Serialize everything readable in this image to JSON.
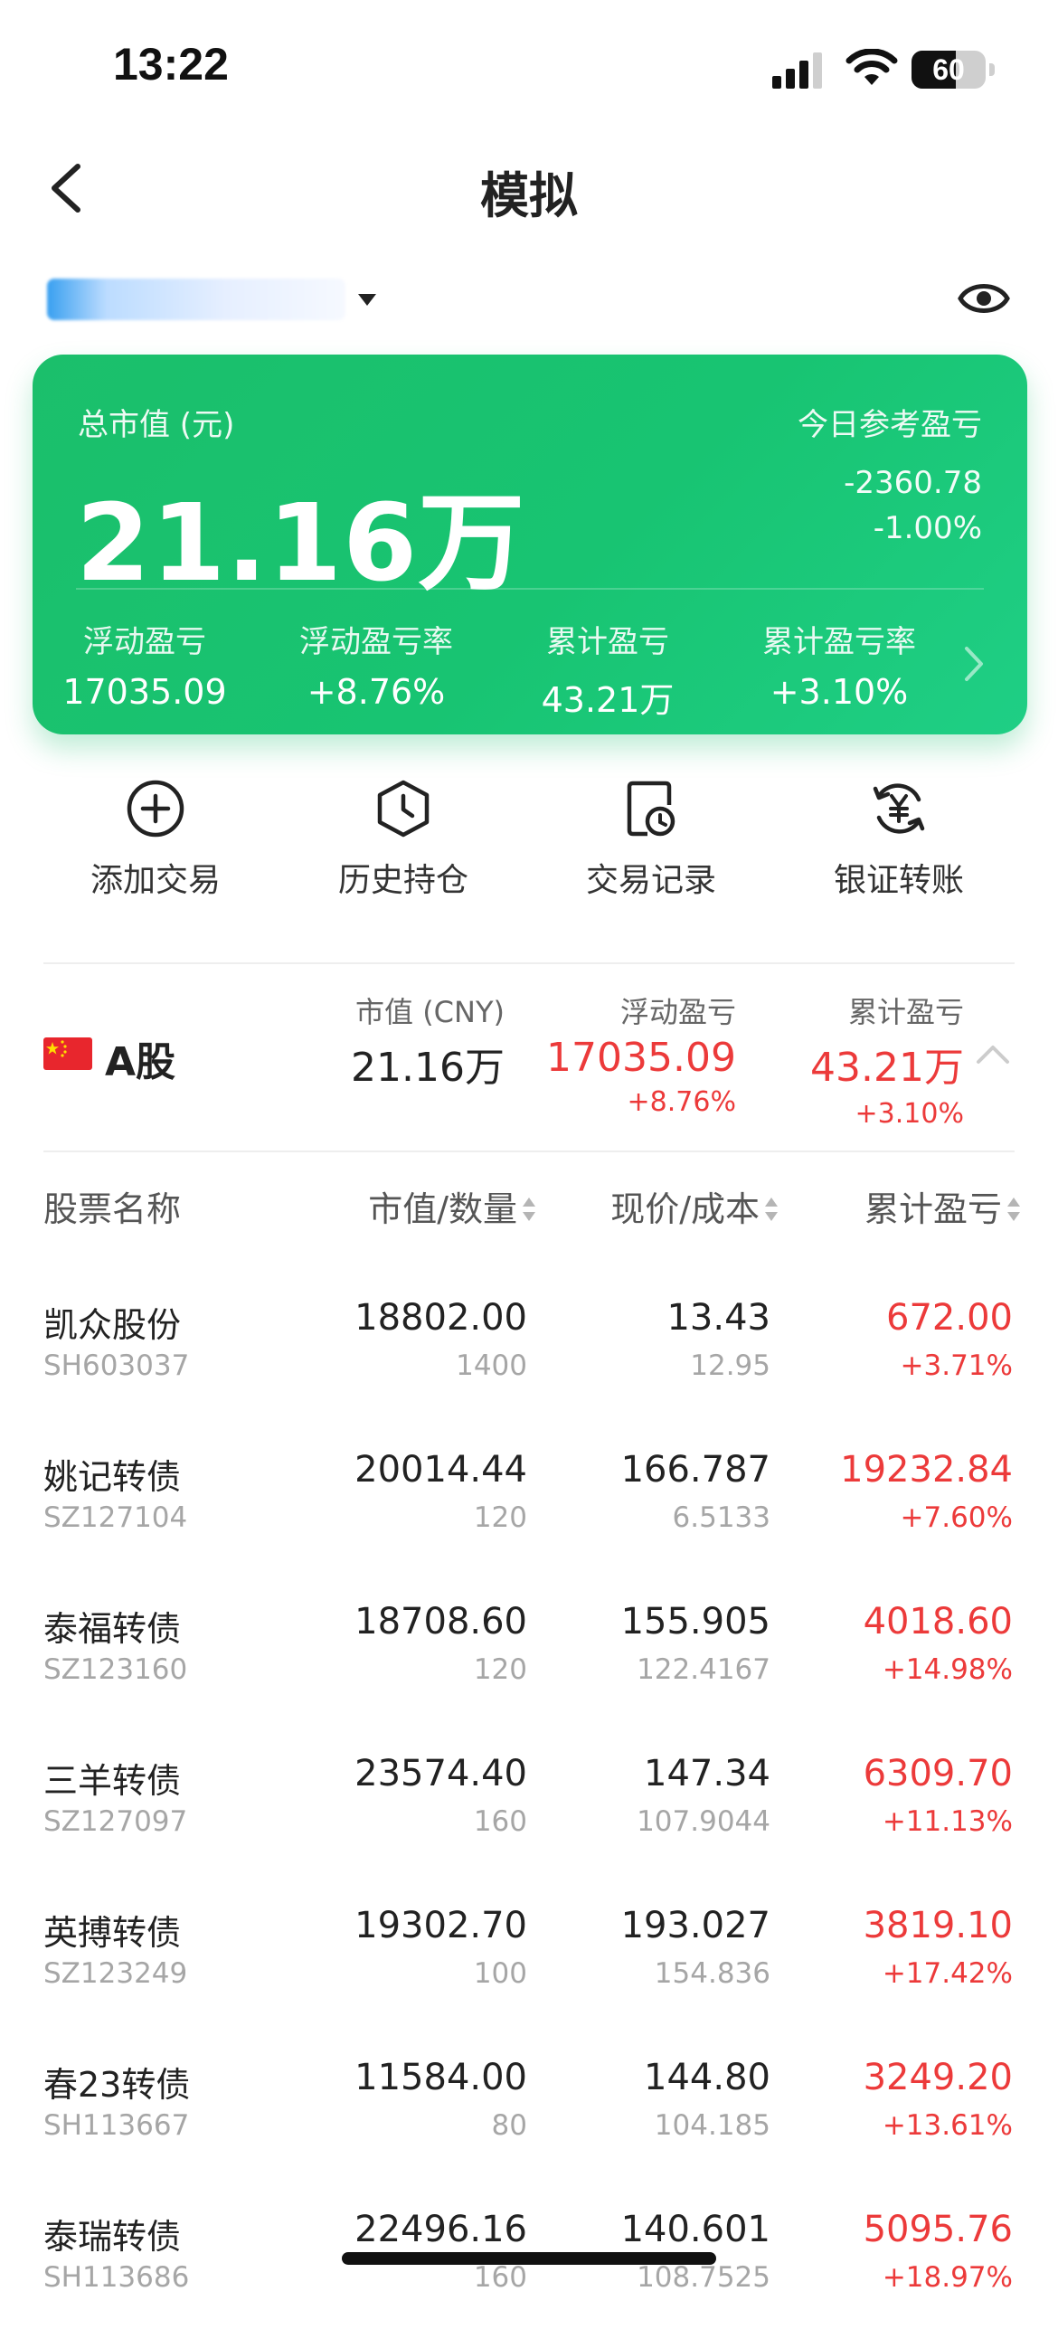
{
  "status_bar": {
    "time": "13:22",
    "battery_level": "60"
  },
  "nav": {
    "title": "模拟"
  },
  "card": {
    "total_label": "总市值 (元)",
    "total_value": "21.16万",
    "today_label": "今日参考盈亏",
    "today_value": "-2360.78",
    "today_pct": "-1.00%",
    "metrics": [
      {
        "label": "浮动盈亏",
        "value": "17035.09"
      },
      {
        "label": "浮动盈亏率",
        "value": "+8.76%"
      },
      {
        "label": "累计盈亏",
        "value": "43.21万"
      },
      {
        "label": "累计盈亏率",
        "value": "+3.10%"
      }
    ],
    "colors": {
      "start": "#1bbf6b",
      "end": "#1fcf85"
    }
  },
  "actions": [
    {
      "label": "添加交易",
      "icon": "plus-circle-icon"
    },
    {
      "label": "历史持仓",
      "icon": "clock-hexagon-icon"
    },
    {
      "label": "交易记录",
      "icon": "document-clock-icon"
    },
    {
      "label": "银证转账",
      "icon": "yuan-transfer-icon"
    }
  ],
  "summary": {
    "market": "A股",
    "market_value_label": "市值 (CNY)",
    "market_value": "21.16万",
    "float_label": "浮动盈亏",
    "float_value": "17035.09",
    "float_pct": "+8.76%",
    "cum_label": "累计盈亏",
    "cum_value": "43.21万",
    "cum_pct": "+3.10%"
  },
  "table": {
    "headers": {
      "name": "股票名称",
      "value_qty": "市值/数量",
      "price_cost": "现价/成本",
      "cum_pnl": "累计盈亏"
    },
    "rows": [
      {
        "name": "凯众股份",
        "code": "SH603037",
        "market_value": "18802.00",
        "quantity": "1400",
        "price": "13.43",
        "cost": "12.95",
        "pnl": "672.00",
        "pnl_pct": "+3.71%"
      },
      {
        "name": "姚记转债",
        "code": "SZ127104",
        "market_value": "20014.44",
        "quantity": "120",
        "price": "166.787",
        "cost": "6.5133",
        "pnl": "19232.84",
        "pnl_pct": "+7.60%"
      },
      {
        "name": "泰福转债",
        "code": "SZ123160",
        "market_value": "18708.60",
        "quantity": "120",
        "price": "155.905",
        "cost": "122.4167",
        "pnl": "4018.60",
        "pnl_pct": "+14.98%"
      },
      {
        "name": "三羊转债",
        "code": "SZ127097",
        "market_value": "23574.40",
        "quantity": "160",
        "price": "147.34",
        "cost": "107.9044",
        "pnl": "6309.70",
        "pnl_pct": "+11.13%"
      },
      {
        "name": "英搏转债",
        "code": "SZ123249",
        "market_value": "19302.70",
        "quantity": "100",
        "price": "193.027",
        "cost": "154.836",
        "pnl": "3819.10",
        "pnl_pct": "+17.42%"
      },
      {
        "name": "春23转债",
        "code": "SH113667",
        "market_value": "11584.00",
        "quantity": "80",
        "price": "144.80",
        "cost": "104.185",
        "pnl": "3249.20",
        "pnl_pct": "+13.61%"
      },
      {
        "name": "泰瑞转债",
        "code": "SH113686",
        "market_value": "22496.16",
        "quantity": "160",
        "price": "140.601",
        "cost": "108.7525",
        "pnl": "5095.76",
        "pnl_pct": "+18.97%"
      }
    ]
  },
  "colors": {
    "profit_red": "#ec3a3a",
    "card_green": "#1bbf6b"
  }
}
